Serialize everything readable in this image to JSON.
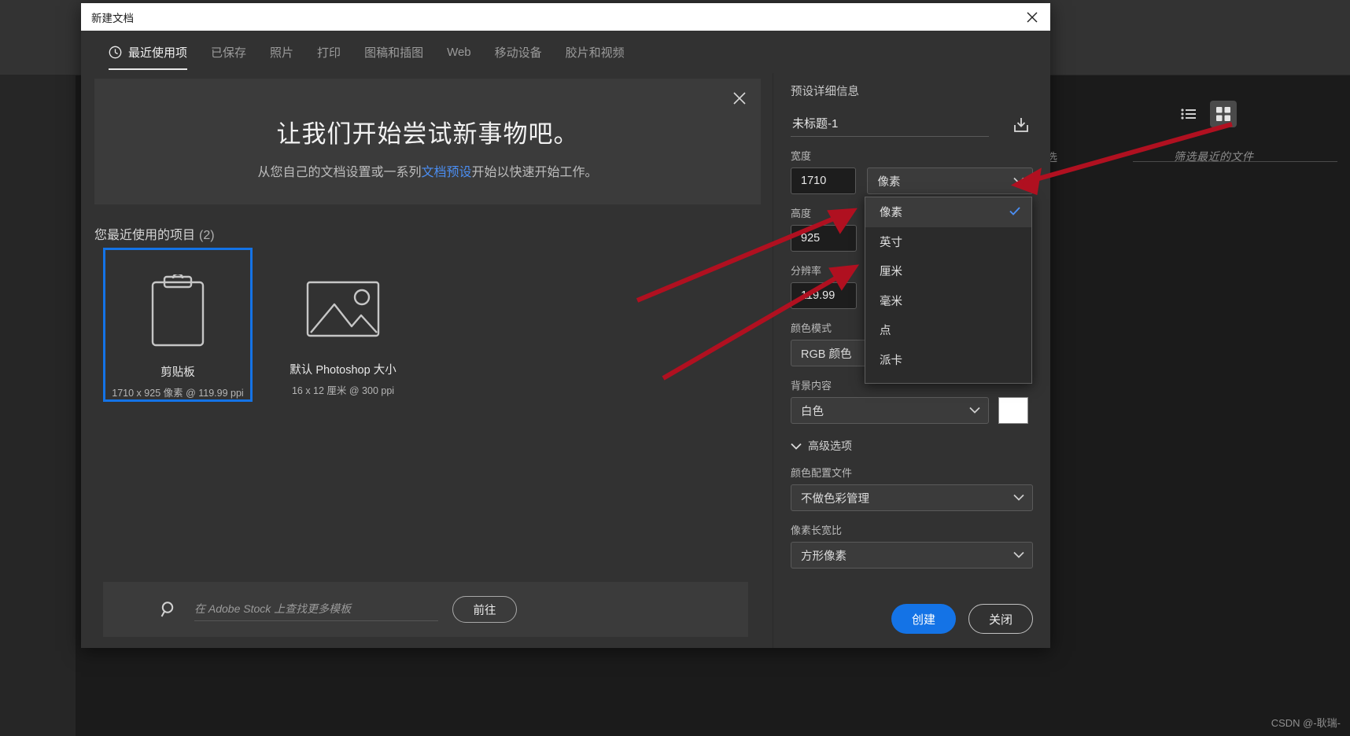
{
  "background": {
    "filter_placeholder": "筛选最近的文件",
    "partial_label": "选",
    "list_view_icon": "list-view-icon",
    "grid_view_icon": "grid-view-icon"
  },
  "dialog": {
    "title": "新建文档",
    "close_icon": "close-icon",
    "tabs": [
      {
        "label": "最近使用项",
        "icon": "clock-icon",
        "active": true
      },
      {
        "label": "已保存",
        "active": false
      },
      {
        "label": "照片",
        "active": false
      },
      {
        "label": "打印",
        "active": false
      },
      {
        "label": "图稿和插图",
        "active": false
      },
      {
        "label": "Web",
        "active": false
      },
      {
        "label": "移动设备",
        "active": false
      },
      {
        "label": "胶片和视频",
        "active": false
      }
    ],
    "banner": {
      "headline": "让我们开始尝试新事物吧。",
      "sub_before": "从您自己的文档设置或一系列",
      "sub_link": "文档预设",
      "sub_after": "开始以快速开始工作。",
      "close_icon": "close-icon"
    },
    "recent": {
      "heading": "您最近使用的项目",
      "count": "(2)",
      "items": [
        {
          "title": "剪贴板",
          "subtitle": "1710 x 925 像素 @ 119.99 ppi",
          "icon": "clipboard-icon",
          "selected": true
        },
        {
          "title": "默认 Photoshop 大小",
          "subtitle": "16 x 12 厘米 @ 300 ppi",
          "icon": "image-placeholder-icon",
          "selected": false
        }
      ]
    },
    "stock": {
      "search_icon": "search-icon",
      "placeholder": "在 Adobe Stock 上查找更多模板",
      "go_label": "前往"
    },
    "preset": {
      "heading": "预设详细信息",
      "name_value": "未标题-1",
      "export_icon": "save-preset-icon",
      "width_label": "宽度",
      "width_value": "1710",
      "unit_value": "像素",
      "height_label": "高度",
      "height_value": "925",
      "resolution_label": "分辨率",
      "resolution_value": "119.99",
      "color_mode_label": "颜色模式",
      "color_mode_value": "RGB 颜色",
      "background_label": "背景内容",
      "background_value": "白色",
      "background_swatch": "#ffffff",
      "advanced_label": "高级选项",
      "advanced_chevron_icon": "chevron-down-icon",
      "profile_label": "颜色配置文件",
      "profile_value": "不做色彩管理",
      "aspect_label": "像素长宽比",
      "aspect_value": "方形像素"
    },
    "unit_dropdown": {
      "options": [
        {
          "label": "像素",
          "selected": true
        },
        {
          "label": "英寸",
          "selected": false
        },
        {
          "label": "厘米",
          "selected": false
        },
        {
          "label": "毫米",
          "selected": false
        },
        {
          "label": "点",
          "selected": false
        },
        {
          "label": "派卡",
          "selected": false
        }
      ],
      "check_icon": "check-icon"
    },
    "buttons": {
      "create_label": "创建",
      "close_label": "关闭",
      "accent_color": "#1473e6"
    }
  },
  "annotation": {
    "arrow_color": "#b01020",
    "arrow_count": 3
  },
  "watermark": "CSDN @-耿瑞-"
}
